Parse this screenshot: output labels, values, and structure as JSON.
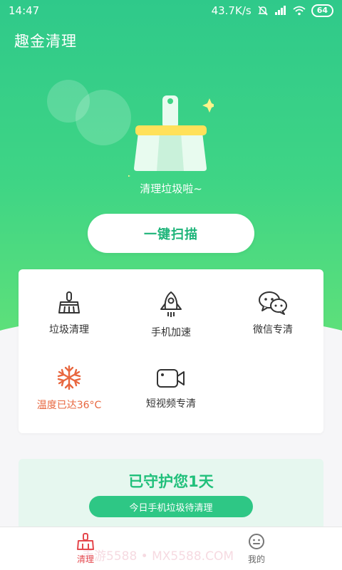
{
  "status_bar": {
    "time": "14:47",
    "network_speed": "43.7K/s",
    "battery": "64"
  },
  "app": {
    "title": "趣金清理"
  },
  "hero": {
    "caption": "清理垃圾啦~",
    "scan_button": "一键扫描"
  },
  "tools": [
    {
      "label": "垃圾清理",
      "icon": "broom-icon"
    },
    {
      "label": "手机加速",
      "icon": "rocket-icon"
    },
    {
      "label": "微信专清",
      "icon": "wechat-icon"
    },
    {
      "label": "温度已达36°C",
      "icon": "snowflake-icon"
    },
    {
      "label": "短视频专清",
      "icon": "video-camera-icon"
    }
  ],
  "protect": {
    "title": "已守护您1天",
    "action": "今日手机垃圾待清理"
  },
  "bottom_nav": {
    "clean": "清理",
    "mine": "我的"
  },
  "watermark": "手游5588 • MX5588.COM",
  "colors": {
    "brand_green": "#2fc98a",
    "warn_orange": "#e8673f",
    "active_red": "#e5484d"
  }
}
